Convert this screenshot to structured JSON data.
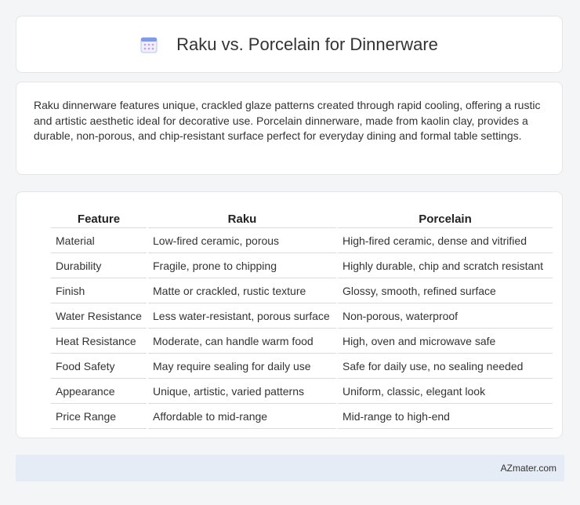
{
  "header": {
    "title": "Raku vs. Porcelain for Dinnerware",
    "icon": "calendar-icon"
  },
  "summary": {
    "text": "Raku dinnerware features unique, crackled glaze patterns created through rapid cooling, offering a rustic and artistic aesthetic ideal for decorative use. Porcelain dinnerware, made from kaolin clay, provides a durable, non-porous, and chip-resistant surface perfect for everyday dining and formal table settings."
  },
  "table": {
    "headers": [
      "Feature",
      "Raku",
      "Porcelain"
    ],
    "rows": [
      [
        "Material",
        "Low-fired ceramic, porous",
        "High-fired ceramic, dense and vitrified"
      ],
      [
        "Durability",
        "Fragile, prone to chipping",
        "Highly durable, chip and scratch resistant"
      ],
      [
        "Finish",
        "Matte or crackled, rustic texture",
        "Glossy, smooth, refined surface"
      ],
      [
        "Water Resistance",
        "Less water-resistant, porous surface",
        "Non-porous, waterproof"
      ],
      [
        "Heat Resistance",
        "Moderate, can handle warm food",
        "High, oven and microwave safe"
      ],
      [
        "Food Safety",
        "May require sealing for daily use",
        "Safe for daily use, no sealing needed"
      ],
      [
        "Appearance",
        "Unique, artistic, varied patterns",
        "Uniform, classic, elegant look"
      ],
      [
        "Price Range",
        "Affordable to mid-range",
        "Mid-range to high-end"
      ]
    ]
  },
  "footer": {
    "text": "AZmater.com"
  },
  "colors": {
    "background": "#f4f5f7",
    "card": "#ffffff",
    "footer_bg": "#e6ecf5",
    "icon_accent": "#8fa8e8"
  }
}
